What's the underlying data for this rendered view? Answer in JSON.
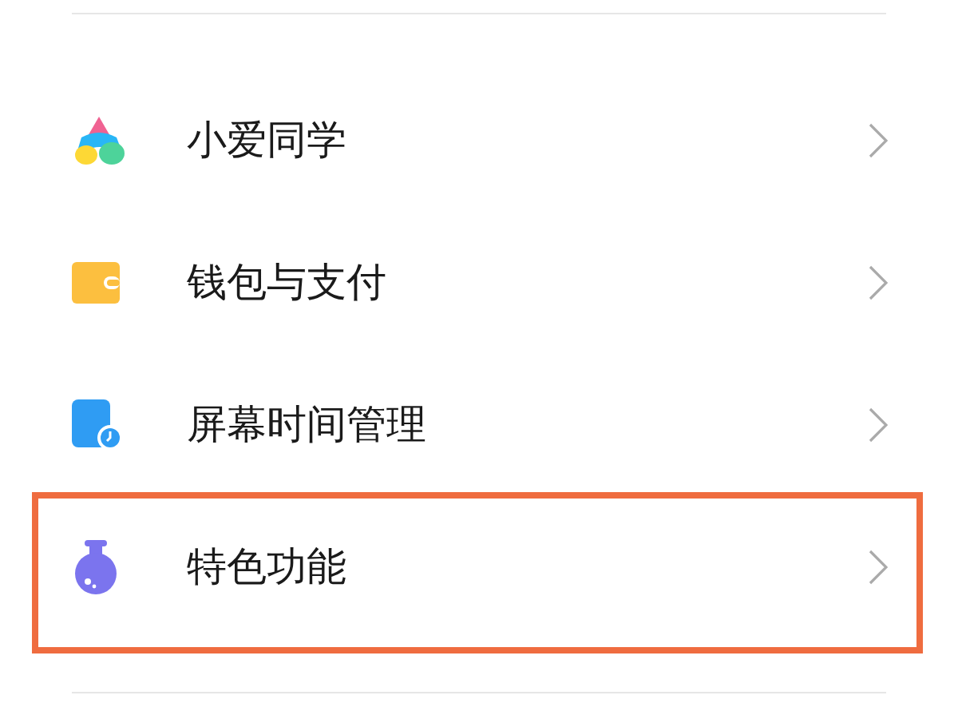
{
  "items": [
    {
      "kind": "assistant",
      "label": "小爱同学",
      "highlighted": false
    },
    {
      "kind": "wallet",
      "label": "钱包与支付",
      "highlighted": false
    },
    {
      "kind": "screentime",
      "label": "屏幕时间管理",
      "highlighted": false
    },
    {
      "kind": "features",
      "label": "特色功能",
      "highlighted": true
    }
  ]
}
